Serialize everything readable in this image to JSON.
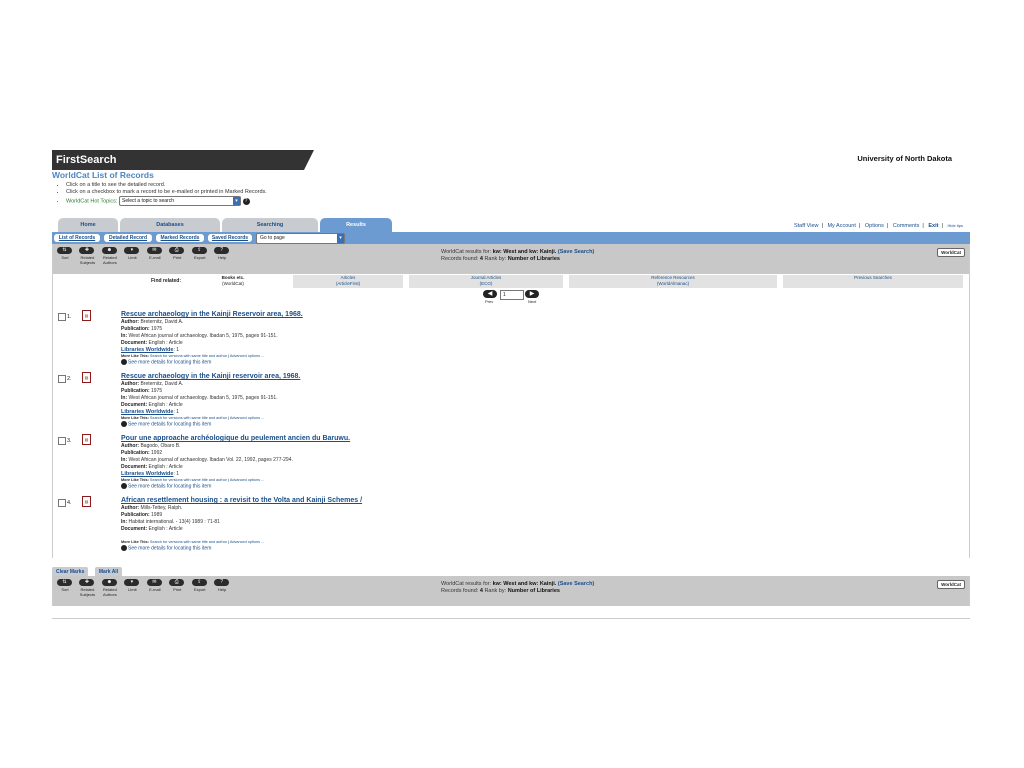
{
  "brand": "FirstSearch",
  "university": "University of North Dakota",
  "page_title": "WorldCat List of Records",
  "tips": [
    "Click on a title to see the detailed record.",
    "Click on a checkbox to mark a record to be e-mailed or printed in Marked Records."
  ],
  "hot_topics_label": "WorldCat Hot Topics:",
  "hot_topics_select": "Select a topic to search",
  "tabs": [
    "Home",
    "Databases",
    "Searching",
    "Results"
  ],
  "top_links": [
    "Staff View",
    "My Account",
    "Options",
    "Comments",
    "Exit",
    "Hide tips"
  ],
  "subtabs": [
    "List of Records",
    "Detailed Record",
    "Marked Records",
    "Saved Records"
  ],
  "goto_select": "Go to page",
  "tools": [
    {
      "icon": "sort-icon",
      "label": "Sort"
    },
    {
      "icon": "related-subjects-icon",
      "label": "Related Subjects"
    },
    {
      "icon": "related-authors-icon",
      "label": "Related Authors"
    },
    {
      "icon": "limit-icon",
      "label": "Limit"
    },
    {
      "icon": "email-icon",
      "label": "E-mail"
    },
    {
      "icon": "print-icon",
      "label": "Print"
    },
    {
      "icon": "export-icon",
      "label": "Export"
    },
    {
      "icon": "help-icon",
      "label": "Help"
    }
  ],
  "results": {
    "prefix": "WorldCat results for:",
    "query": "kw: West and kw: Kainji.",
    "save_search": "(Save Search)",
    "found_label": "Records found:",
    "found_count": "4",
    "rank_label": "Rank by:",
    "rank_value": "Number of Libraries"
  },
  "worldcat_logo": "WorldCat",
  "find_related": {
    "label": "Find related:",
    "cols": [
      {
        "title": "Books etc.",
        "sub": "(WorldCat)"
      },
      {
        "title": "Articles",
        "sub": "(ArticleFirst)"
      },
      {
        "title": "Journal Articles",
        "sub": "(ECO)"
      },
      {
        "title": "Reference Resources",
        "sub": "(WorldAlmanac)"
      },
      {
        "title": "Previous Searches",
        "sub": ""
      }
    ]
  },
  "pager": {
    "page": "1",
    "prev": "Prev",
    "next": "Next"
  },
  "records": [
    {
      "num": "1.",
      "title": "Rescue archaeology in the Kainji Reservoir area, 1968.",
      "author": "Breternitz, David A.",
      "publication": "1975",
      "in": "West African journal of archaeology. Ibadan 5, 1975, pages 91-151.",
      "document": "English : Article",
      "libraries": "1",
      "more_like": "Search for versions with same title and author",
      "advanced": "Advanced options ...",
      "see_more": "See more details for locating this item"
    },
    {
      "num": "2.",
      "title": "Rescue archaeology in the Kainji reservoir area, 1968.",
      "author": "Breternitz, David A.",
      "publication": "1975",
      "in": "West African journal of archaeology. Ibadan 5, 1975, pages 91-151.",
      "document": "English : Article",
      "libraries": "1",
      "more_like": "Search for versions with same title and author",
      "advanced": "Advanced options ...",
      "see_more": "See more details for locating this item"
    },
    {
      "num": "3.",
      "title": "Pour une approache archéologique du peulement ancien du Baruwu.",
      "author": "Bagodo, Obaro B.",
      "publication": "1992",
      "in": "West African journal of archaeology. Ibadan Vol. 22, 1992, pages 277-294.",
      "document": "English : Article",
      "libraries": "1",
      "more_like": "Search for versions with same title and author",
      "advanced": "Advanced options ...",
      "see_more": "See more details for locating this item"
    },
    {
      "num": "4.",
      "title": "African resettlement housing : a revisit to the Volta and Kainji Schemes /",
      "author": "Mills-Tettey, Ralph.",
      "publication": "1989",
      "in": "Habitat international. - 13(4) 1989 : 71-81",
      "document": "English : Article",
      "libraries": "",
      "more_like": "Search for versions with same title and author",
      "advanced": "Advanced options ...",
      "see_more": "See more details for locating this item"
    }
  ],
  "labels": {
    "author": "Author:",
    "publication": "Publication:",
    "in": "In:",
    "document": "Document:",
    "libraries": "Libraries Worldwide",
    "more_like": "More Like This:"
  },
  "mark_buttons": [
    "Clear Marks",
    "Mark All"
  ]
}
